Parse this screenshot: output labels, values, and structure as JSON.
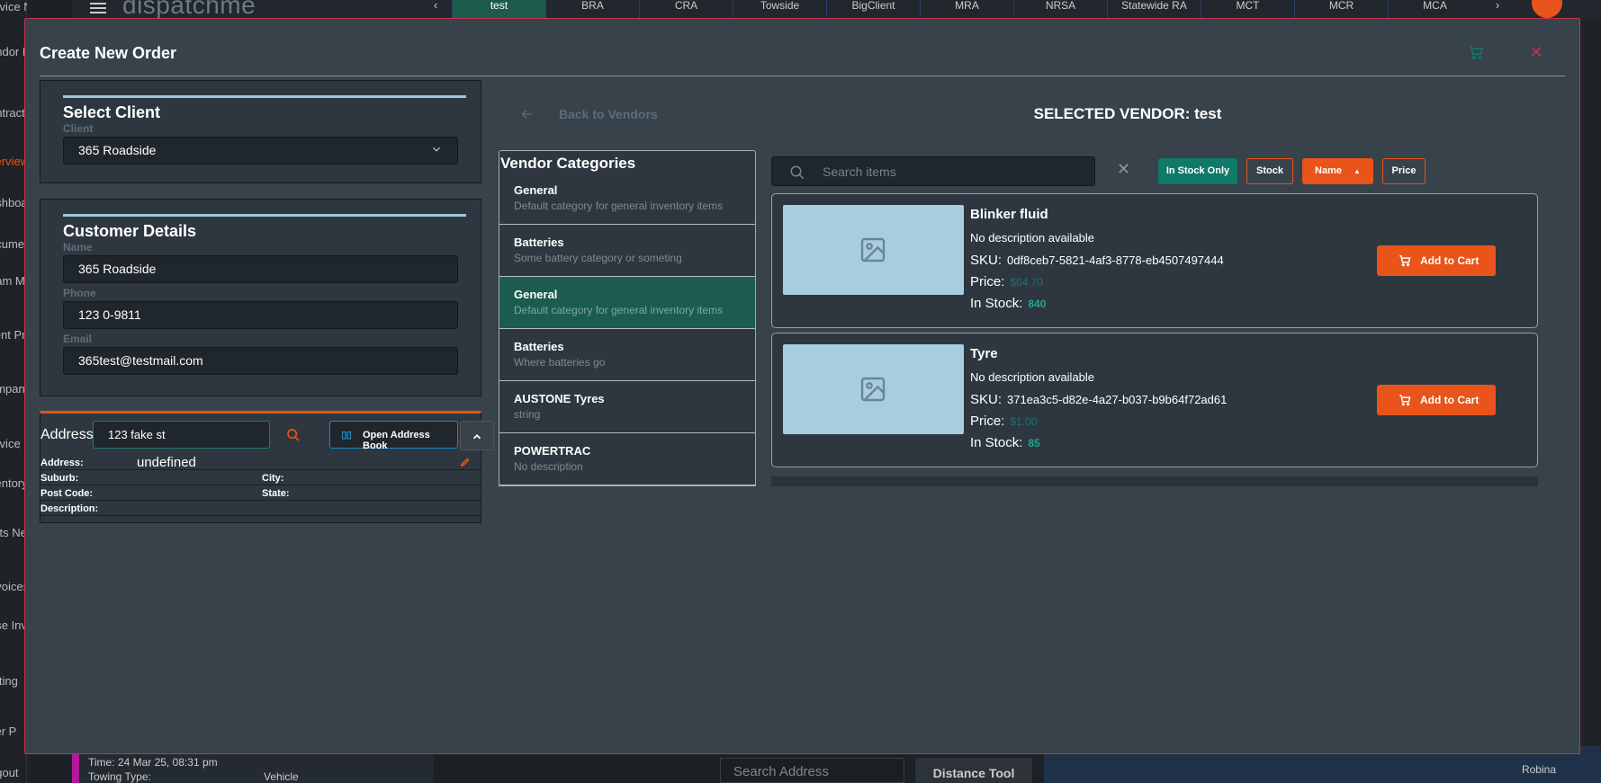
{
  "background": {
    "sidebar": [
      {
        "label": "ervice Network"
      },
      {
        "label": "endor Profiles"
      },
      {
        "label": "ontract"
      },
      {
        "label": "verview"
      },
      {
        "label": "ashboard"
      },
      {
        "label": "ocument"
      },
      {
        "label": "eam Member"
      },
      {
        "label": "lient Profiles"
      },
      {
        "label": "ompany Select"
      },
      {
        "label": "ervice"
      },
      {
        "label": "ventory"
      },
      {
        "label": "arts Network"
      },
      {
        "label": "nvoices"
      },
      {
        "label": "ase Invoicing"
      },
      {
        "label": "etting"
      },
      {
        "label": "ser P"
      },
      {
        "label": "ogout"
      }
    ],
    "logo": "dispatchme",
    "tabs": [
      "test",
      "BRA",
      "CRA",
      "Towside",
      "BigClient",
      "MRA",
      "NRSA",
      "Statewide RA",
      "MCT",
      "MCR",
      "MCA"
    ],
    "active_tab": "test",
    "bottom_card": {
      "time": "Time: 24 Mar 25, 08:31 pm",
      "towing_type_label": "Towing Type:",
      "towing_type_value": "Vehicle"
    },
    "search_address_placeholder": "Search Address",
    "distance_tool_label": "Distance Tool",
    "map_label": "Robina"
  },
  "modal": {
    "title": "Create New Order",
    "select_client": {
      "title": "Select Client",
      "client_label": "Client",
      "client_value": "365 Roadside"
    },
    "customer_details": {
      "title": "Customer Details",
      "name_label": "Name",
      "name_value": "365 Roadside",
      "phone_label": "Phone",
      "phone_value": "123 0-9811",
      "email_label": "Email",
      "email_value": "365test@testmail.com"
    },
    "address": {
      "label": "Address",
      "input_value": "123 fake st",
      "open_book_label": "Open Address Book",
      "address_key": "Address:",
      "address_value": "undefined",
      "suburb_key": "Suburb:",
      "city_key": "City:",
      "postcode_key": "Post Code:",
      "state_key": "State:",
      "description_key": "Description:"
    },
    "back_label": "Back to Vendors",
    "selected_vendor": "SELECTED VENDOR: test",
    "categories_title": "Vendor Categories",
    "categories": [
      {
        "name": "General",
        "desc": "Default category for general inventory items",
        "active": false
      },
      {
        "name": "Batteries",
        "desc": "Some battery category or someting",
        "active": false
      },
      {
        "name": "General",
        "desc": "Default category for general inventory items",
        "active": true
      },
      {
        "name": "Batteries",
        "desc": "Where batteries go",
        "active": false
      },
      {
        "name": "AUSTONE Tyres",
        "desc": "string",
        "active": false
      },
      {
        "name": "POWERTRAC",
        "desc": "No description",
        "active": false
      }
    ],
    "search_placeholder": "Search items",
    "filters": {
      "in_stock_only": "In Stock Only",
      "stock": "Stock",
      "name": "Name",
      "price": "Price"
    },
    "items": [
      {
        "name": "Blinker fluid",
        "description": "No description available",
        "sku_label": "SKU:",
        "sku": "0df8ceb7-5821-4af3-8778-eb4507497444",
        "price_label": "Price:",
        "price": "$64.70",
        "stock_label": "In Stock:",
        "stock": "840",
        "add_label": "Add to Cart"
      },
      {
        "name": "Tyre",
        "description": "No description available",
        "sku_label": "SKU:",
        "sku": "371ea3c5-d82e-4a27-b037-b9b64f72ad61",
        "price_label": "Price:",
        "price": "$1.00",
        "stock_label": "In Stock:",
        "stock": "85",
        "add_label": "Add to Cart"
      }
    ]
  },
  "colors": {
    "accent_orange": "#e8541a",
    "accent_teal": "#0f7a68",
    "close_red": "#c2334d",
    "modal_bg": "#37424b"
  }
}
